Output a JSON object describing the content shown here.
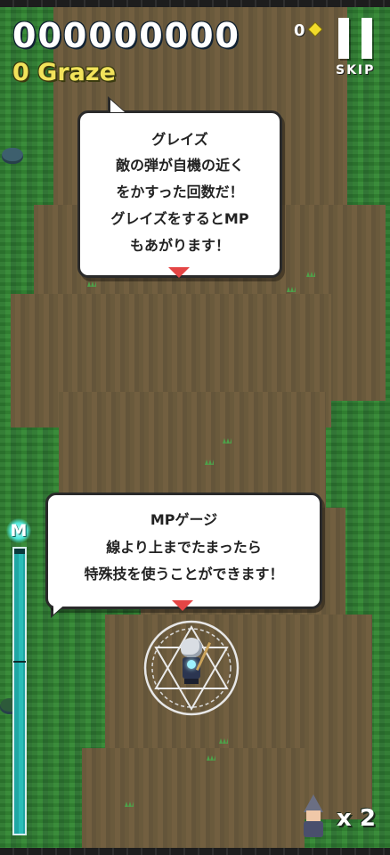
{
  "hud": {
    "score": "000000000",
    "graze": "0 Graze",
    "gem_count": "0",
    "skip_label": "SKIP",
    "lives": "x 2"
  },
  "tutorial": {
    "graze_bubble": {
      "title": "グレイズ",
      "lines": [
        "敵の弾が自機の近く",
        "をかすった回数だ！",
        "グレイズをするとMP",
        "もあがります！"
      ]
    },
    "mp_bubble": {
      "title": "MPゲージ",
      "lines": [
        "線より上までたまったら",
        "特殊技を使うことができます！"
      ]
    }
  },
  "mp_gauge": {
    "label": "M",
    "level": 0.98,
    "threshold": 0.6
  },
  "colors": {
    "graze_text": "#f2e35b",
    "gauge_fill": "#2abdb8",
    "next_marker": "#e44545",
    "gem": "#f3dc2a"
  }
}
